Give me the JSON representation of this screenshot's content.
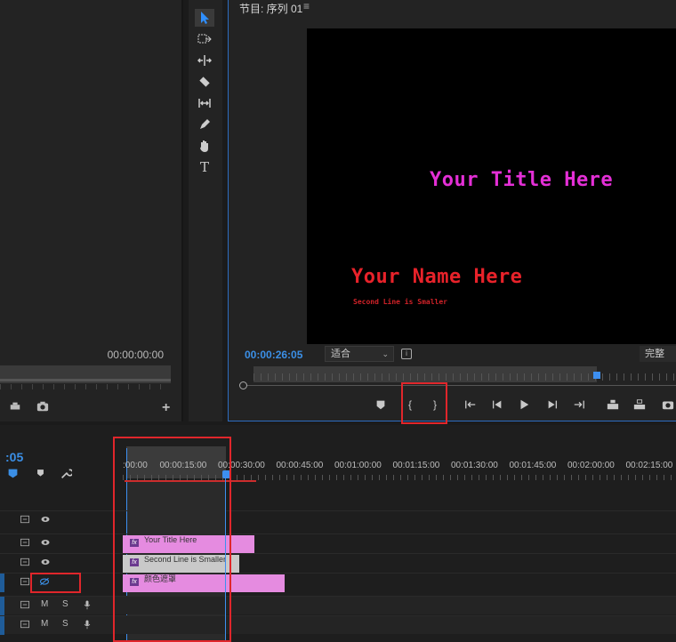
{
  "source_monitor": {
    "timecode": "00:00:00:00",
    "controls": [
      "export-frame",
      "camera",
      "add"
    ]
  },
  "tools": [
    "selection",
    "track-select-forward",
    "ripple-edit",
    "razor",
    "slip",
    "pen",
    "hand",
    "type"
  ],
  "program_monitor": {
    "title": "节目: 序列 01",
    "menu_glyph": "≡",
    "timecode": "00:00:26:05",
    "fit_label": "适合",
    "quality_label": "完整",
    "video_texts": {
      "title": "Your Title Here",
      "name": "Your Name Here",
      "second_line": "Second Line is Smaller"
    },
    "controls": {
      "marker": "♥",
      "mark_in": "{",
      "mark_out": "}",
      "goto_in": "{←",
      "step_back": "◀|",
      "play": "▶",
      "step_forward": "|▶",
      "goto_out": "→}",
      "lift": "lift",
      "extract": "extract",
      "export_frame": "camera"
    }
  },
  "timeline": {
    "timecode": ":05",
    "ruler": [
      ":00:00",
      "00:00:15:00",
      "00:00:30:00",
      "00:00:45:00",
      "00:01:00:00",
      "00:01:15:00",
      "00:01:30:00",
      "00:01:45:00",
      "00:02:00:00",
      "00:02:15:00"
    ],
    "tracks": [
      {
        "clip": "Your Title Here",
        "color": "#e58be0"
      },
      {
        "clip": "Second Line is Smaller",
        "color": "#c9c9c9"
      },
      {
        "clip": "颜色遮罩",
        "color": "#e58be0"
      }
    ],
    "audio_track_labels": {
      "mute": "M",
      "solo": "S"
    }
  },
  "colors": {
    "accent_blue": "#3b8fe6",
    "highlight_red": "#e0262b",
    "title_magenta": "#e42fd6",
    "name_red": "#e8222a"
  }
}
